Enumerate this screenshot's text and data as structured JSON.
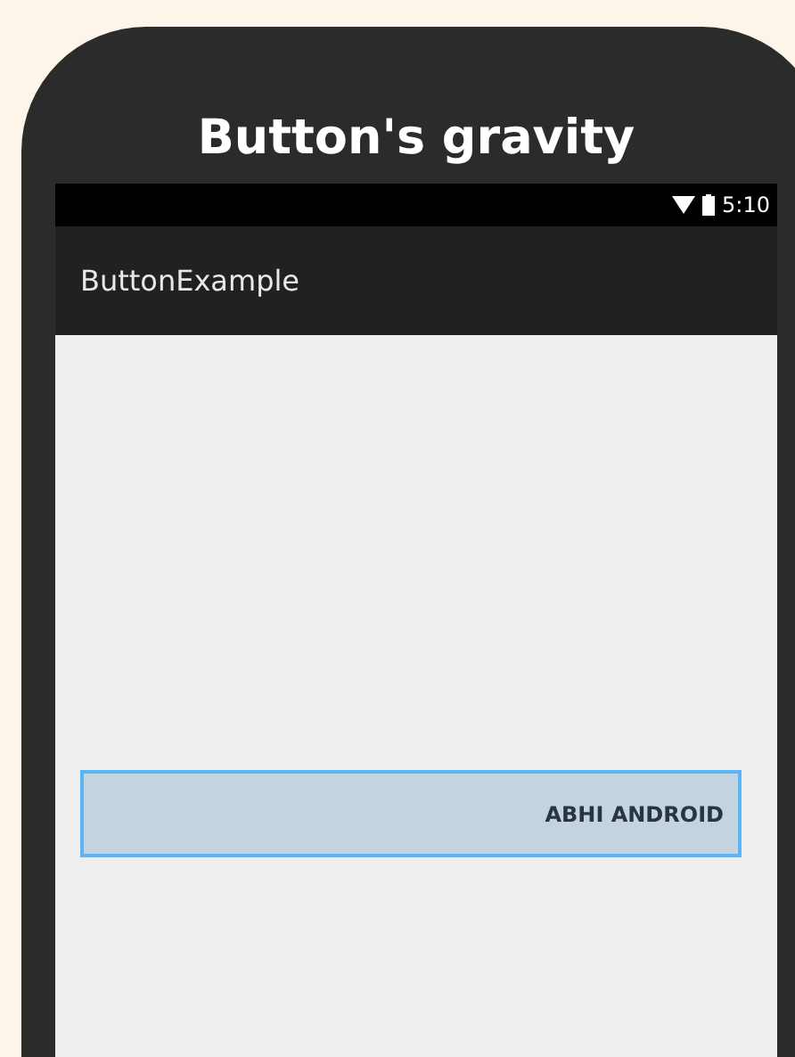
{
  "title": "Button's gravity",
  "status_bar": {
    "time": "5:10"
  },
  "app_bar": {
    "title": "ButtonExample"
  },
  "button": {
    "label": "ABHI ANDROID",
    "focused": true
  }
}
